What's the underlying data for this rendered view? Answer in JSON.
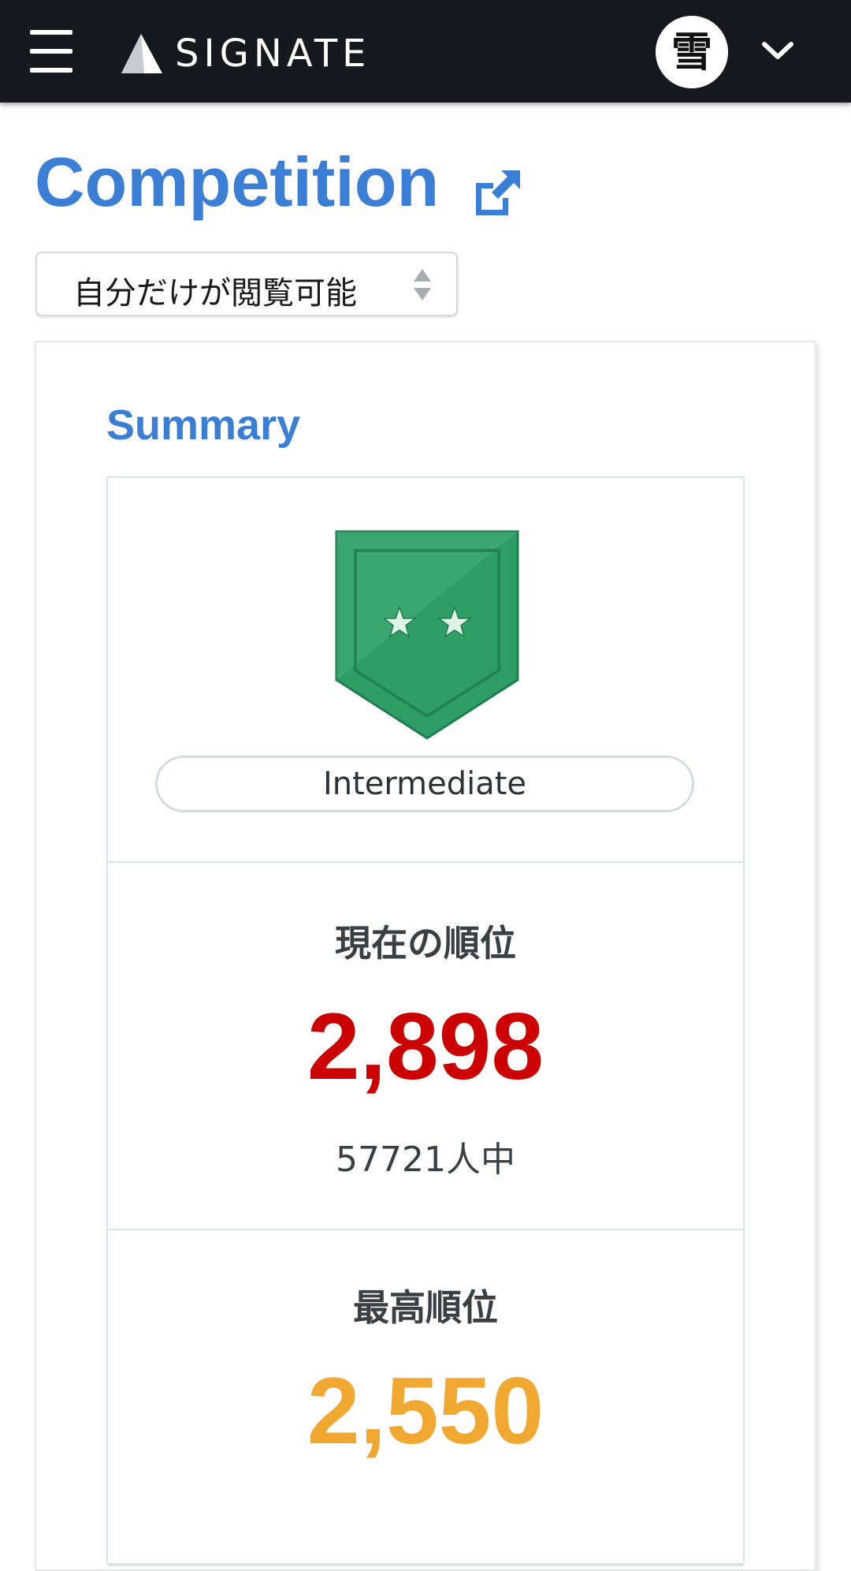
{
  "header": {
    "logo_text": "SIGNATE",
    "avatar_char": "雪",
    "menu_icon": "hamburger-menu-icon",
    "caret_icon": "chevron-down-icon"
  },
  "page": {
    "title": "Competition",
    "external_icon": "external-link-icon"
  },
  "visibility_select": {
    "selected": "自分だけが閲覧可能"
  },
  "summary": {
    "title": "Summary",
    "rank_badge": {
      "stars": 2,
      "color": "#2e9e66"
    },
    "rank_name": "Intermediate",
    "current_rank": {
      "label": "現在の順位",
      "value": "2,898",
      "out_of": "57721人中",
      "color": "#cc0000"
    },
    "best_rank": {
      "label": "最高順位",
      "value": "2,550",
      "color": "#f0a830"
    }
  },
  "colors": {
    "accent": "#3a7fd5",
    "topbar": "#15191d"
  }
}
